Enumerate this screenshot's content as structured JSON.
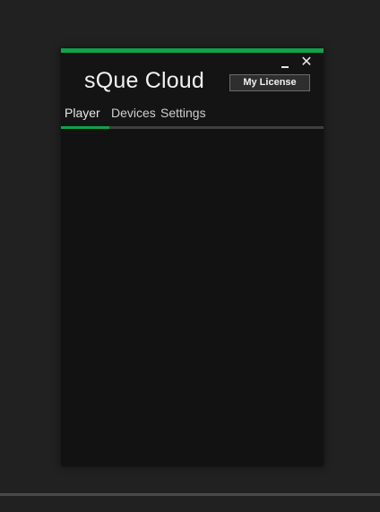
{
  "window": {
    "title": "sQue Cloud",
    "minimize_icon": "minimize-icon",
    "close_glyph": "✕",
    "accent_color": "#12a14a"
  },
  "header": {
    "license_button": "My License"
  },
  "tabs": [
    {
      "label": "Player",
      "active": true
    },
    {
      "label": "Devices",
      "active": false
    },
    {
      "label": "Settings",
      "active": false
    }
  ]
}
